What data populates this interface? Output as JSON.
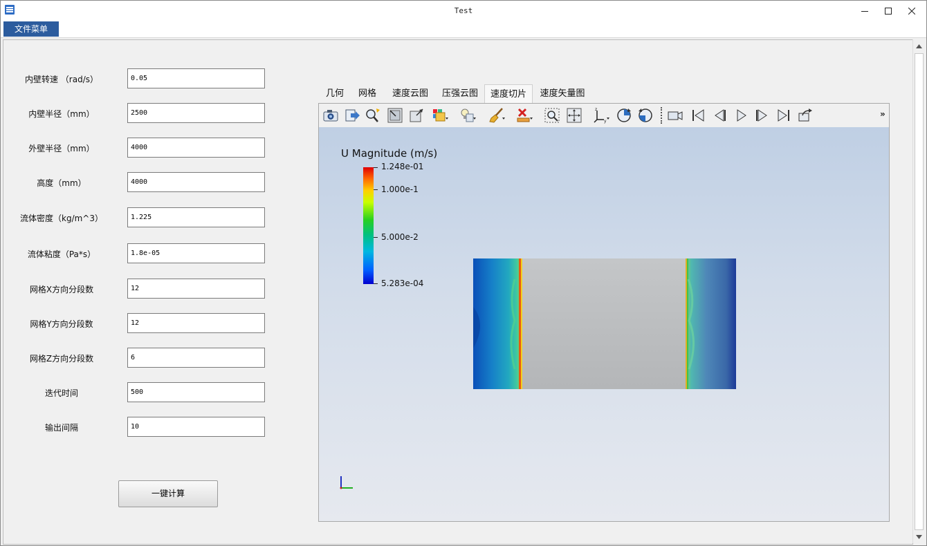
{
  "window": {
    "title": "Test"
  },
  "menu": {
    "file": "文件菜单"
  },
  "form": {
    "fields": [
      {
        "label": "内壁转速 （rad/s）",
        "value": "0.05"
      },
      {
        "label": "内壁半径（mm）",
        "value": "2500"
      },
      {
        "label": "外壁半径（mm）",
        "value": "4000"
      },
      {
        "label": "高度（mm）",
        "value": "4000"
      },
      {
        "label": "流体密度（kg/m^3）",
        "value": "1.225"
      },
      {
        "label": "流体粘度（Pa*s）",
        "value": "1.8e-05"
      },
      {
        "label": "网格X方向分段数",
        "value": "12"
      },
      {
        "label": "网格Y方向分段数",
        "value": "12"
      },
      {
        "label": "网格Z方向分段数",
        "value": "6"
      },
      {
        "label": "迭代时间",
        "value": "500"
      },
      {
        "label": "输出间隔",
        "value": "10"
      }
    ],
    "calc_button": "一键计算"
  },
  "tabs": [
    {
      "label": "几何"
    },
    {
      "label": "网格"
    },
    {
      "label": "速度云图"
    },
    {
      "label": "压强云图"
    },
    {
      "label": "速度切片",
      "active": true
    },
    {
      "label": "速度矢量图"
    }
  ],
  "toolbar": {
    "icons": [
      "camera-icon",
      "export-icon",
      "find-data-icon",
      "select-points-icon",
      "select-cells-icon",
      "color-map-icon",
      "light-bulb-icon",
      "brush-clear-icon",
      "delete-icon",
      "zoom-box-icon",
      "reset-camera-icon",
      "axes-orientation-icon",
      "rotate-cw-icon",
      "rotate-ccw-icon",
      "record-icon",
      "first-frame-icon",
      "previous-frame-icon",
      "play-icon",
      "next-frame-icon",
      "last-frame-icon",
      "loop-icon"
    ],
    "overflow": "»"
  },
  "viewer": {
    "legend": {
      "title": "U Magnitude (m/s)",
      "max": "1.248e-01",
      "tick1": "1.000e-1",
      "tick2": "5.000e-2",
      "min": "5.283e-04",
      "range": [
        0.0005283,
        0.1248
      ],
      "ticks": [
        0.1,
        0.05
      ]
    }
  }
}
